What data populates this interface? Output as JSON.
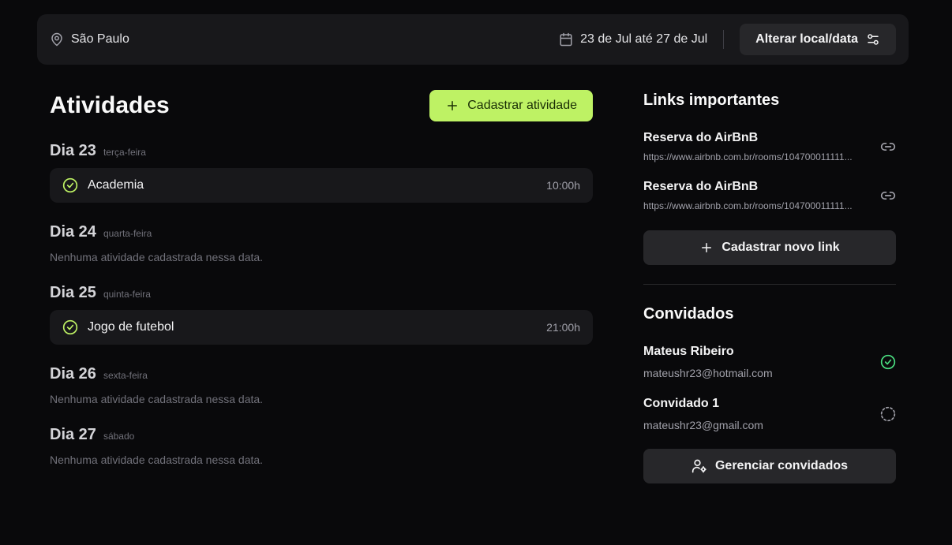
{
  "header": {
    "location": "São Paulo",
    "date_range": "23 de Jul até 27 de Jul",
    "change_button": "Alterar local/data"
  },
  "activities": {
    "title": "Atividades",
    "add_button": "Cadastrar atividade",
    "empty_text": "Nenhuma atividade cadastrada nessa data.",
    "days": [
      {
        "day": "Dia 23",
        "weekday": "terça-feira",
        "items": [
          {
            "title": "Academia",
            "time": "10:00h"
          }
        ]
      },
      {
        "day": "Dia 24",
        "weekday": "quarta-feira",
        "items": []
      },
      {
        "day": "Dia 25",
        "weekday": "quinta-feira",
        "items": [
          {
            "title": "Jogo de futebol",
            "time": "21:00h"
          }
        ]
      },
      {
        "day": "Dia 26",
        "weekday": "sexta-feira",
        "items": []
      },
      {
        "day": "Dia 27",
        "weekday": "sábado",
        "items": []
      }
    ]
  },
  "links": {
    "title": "Links importantes",
    "items": [
      {
        "name": "Reserva do AirBnB",
        "url": "https://www.airbnb.com.br/rooms/104700011111..."
      },
      {
        "name": "Reserva do AirBnB",
        "url": "https://www.airbnb.com.br/rooms/104700011111..."
      }
    ],
    "add_button": "Cadastrar novo link"
  },
  "guests": {
    "title": "Convidados",
    "items": [
      {
        "name": "Mateus Ribeiro",
        "email": "mateushr23@hotmail.com",
        "status": "confirmed"
      },
      {
        "name": "Convidado 1",
        "email": "mateushr23@gmail.com",
        "status": "pending"
      }
    ],
    "manage_button": "Gerenciar convidados"
  },
  "colors": {
    "accent": "#bef264",
    "confirmed": "#4ade80",
    "background": "#09090b",
    "surface": "#18181b"
  }
}
